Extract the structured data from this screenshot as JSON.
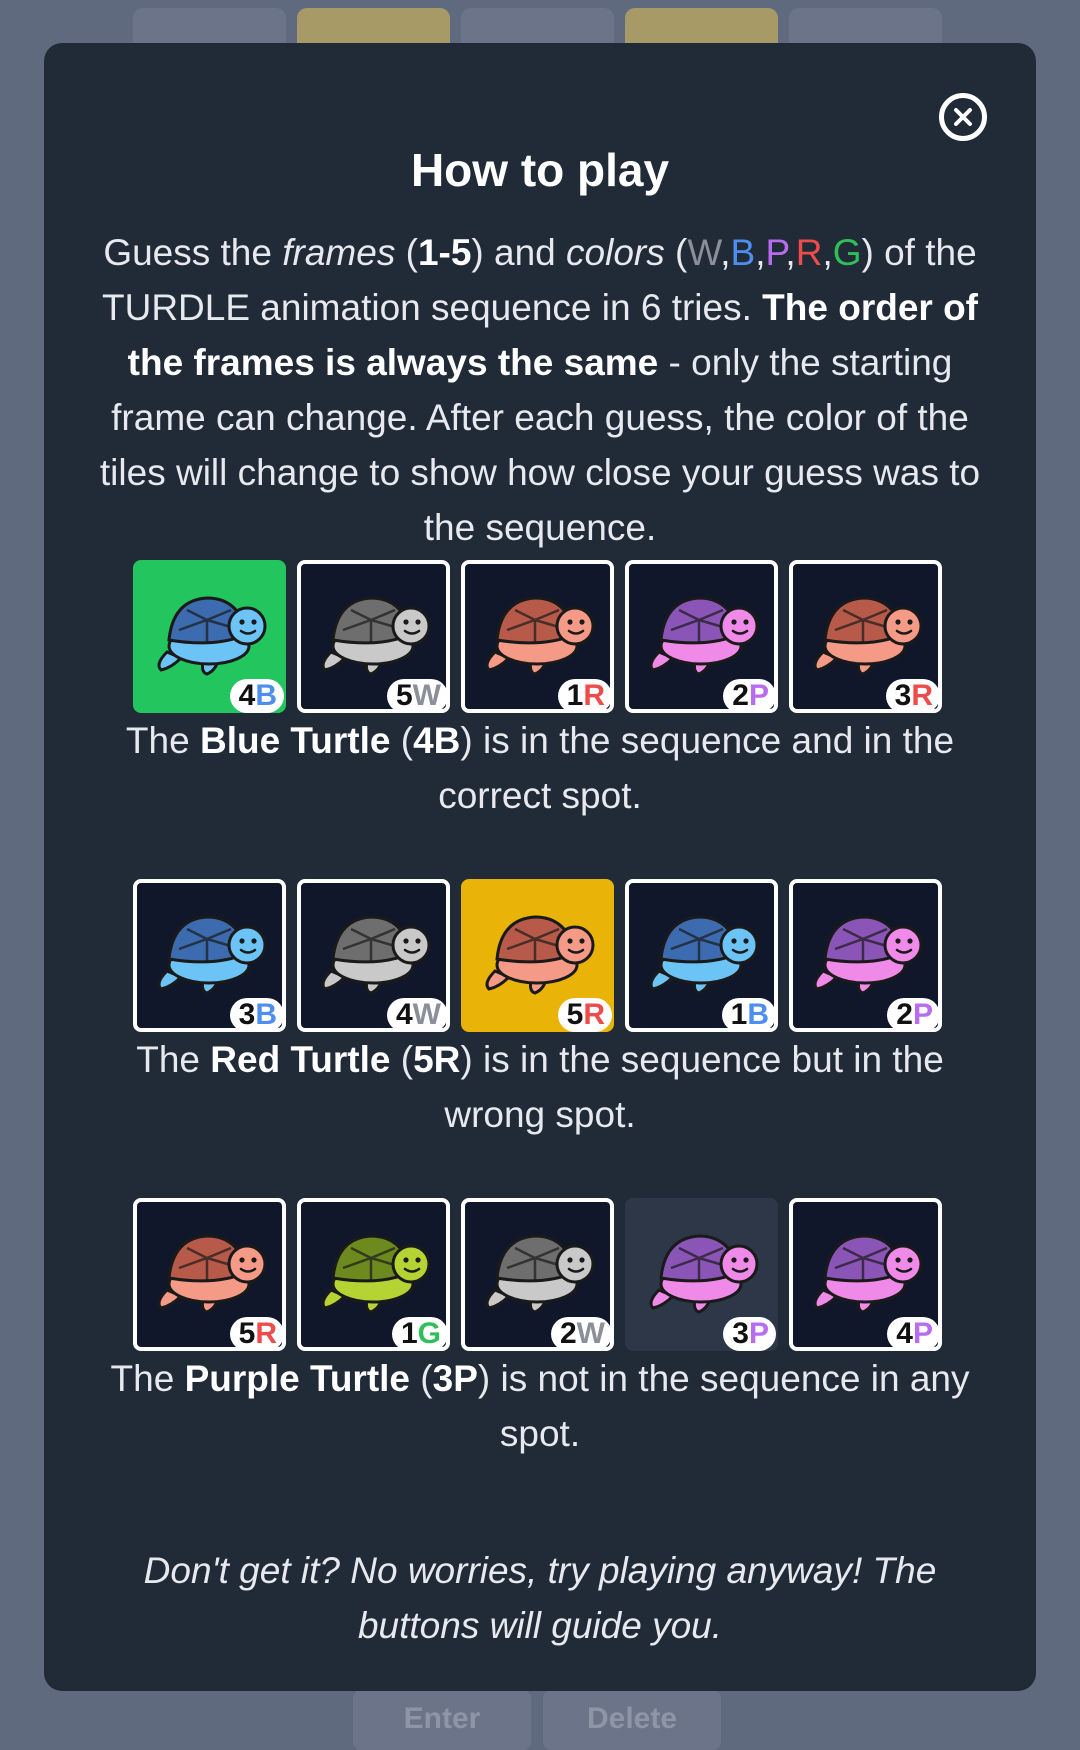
{
  "background": {
    "keys": {
      "enter_label": "Enter",
      "delete_label": "Delete"
    }
  },
  "modal": {
    "title": "How to play",
    "intro": {
      "p1": "Guess the ",
      "frames_word": "frames",
      "p2": " (",
      "range": "1-5",
      "p3": ") and ",
      "colors_word": "colors",
      "p4": " (",
      "color_letters": [
        "W",
        "B",
        "P",
        "R",
        "G"
      ],
      "p5": ") of the TURDLE animation sequence in 6 tries. ",
      "bold": "The order of the frames is always the same",
      "p6": " - only the starting frame can change. After each guess, the color of the tiles will change to show how close your guess was to the sequence."
    },
    "examples": [
      {
        "tiles": [
          {
            "frame": "4",
            "color": "B",
            "state": "correct"
          },
          {
            "frame": "5",
            "color": "W",
            "state": "normal"
          },
          {
            "frame": "1",
            "color": "R",
            "state": "normal"
          },
          {
            "frame": "2",
            "color": "P",
            "state": "normal"
          },
          {
            "frame": "3",
            "color": "R",
            "state": "normal"
          }
        ],
        "text_before": "The ",
        "turtle_name": "Blue Turtle",
        "code_num": "4",
        "code_letter": "B",
        "text_after": " is in the sequence and in the correct spot."
      },
      {
        "tiles": [
          {
            "frame": "3",
            "color": "B",
            "state": "normal"
          },
          {
            "frame": "4",
            "color": "W",
            "state": "normal"
          },
          {
            "frame": "5",
            "color": "R",
            "state": "present"
          },
          {
            "frame": "1",
            "color": "B",
            "state": "normal"
          },
          {
            "frame": "2",
            "color": "P",
            "state": "normal"
          }
        ],
        "text_before": "The ",
        "turtle_name": "Red Turtle",
        "code_num": "5",
        "code_letter": "R",
        "text_after": " is in the sequence but in the wrong spot."
      },
      {
        "tiles": [
          {
            "frame": "5",
            "color": "R",
            "state": "normal"
          },
          {
            "frame": "1",
            "color": "G",
            "state": "normal"
          },
          {
            "frame": "2",
            "color": "W",
            "state": "normal"
          },
          {
            "frame": "3",
            "color": "P",
            "state": "absent"
          },
          {
            "frame": "4",
            "color": "P",
            "state": "normal"
          }
        ],
        "text_before": "The ",
        "turtle_name": "Purple Turtle",
        "code_num": "3",
        "code_letter": "P",
        "text_after": " is not in the sequence in any spot."
      }
    ],
    "footer": "Don't get it? No worries, try playing anyway! The buttons will guide you."
  },
  "colors": {
    "letter_colors": {
      "W": "#8b8f99",
      "B": "#4e8ef0",
      "P": "#b86cf0",
      "R": "#ee4b4b",
      "G": "#2fbf5a"
    },
    "turtle_shell": {
      "W": "#6e6e6e",
      "B": "#3d6bb0",
      "P": "#8b55b8",
      "R": "#b85a4a",
      "G": "#6d8a1e"
    },
    "turtle_body": {
      "W": "#c9c9c9",
      "B": "#6cc3f5",
      "P": "#f08ae8",
      "R": "#f59a86",
      "G": "#b6d334"
    },
    "state_correct": "#22c55e",
    "state_present": "#eab308",
    "state_absent": "#2d3748"
  }
}
